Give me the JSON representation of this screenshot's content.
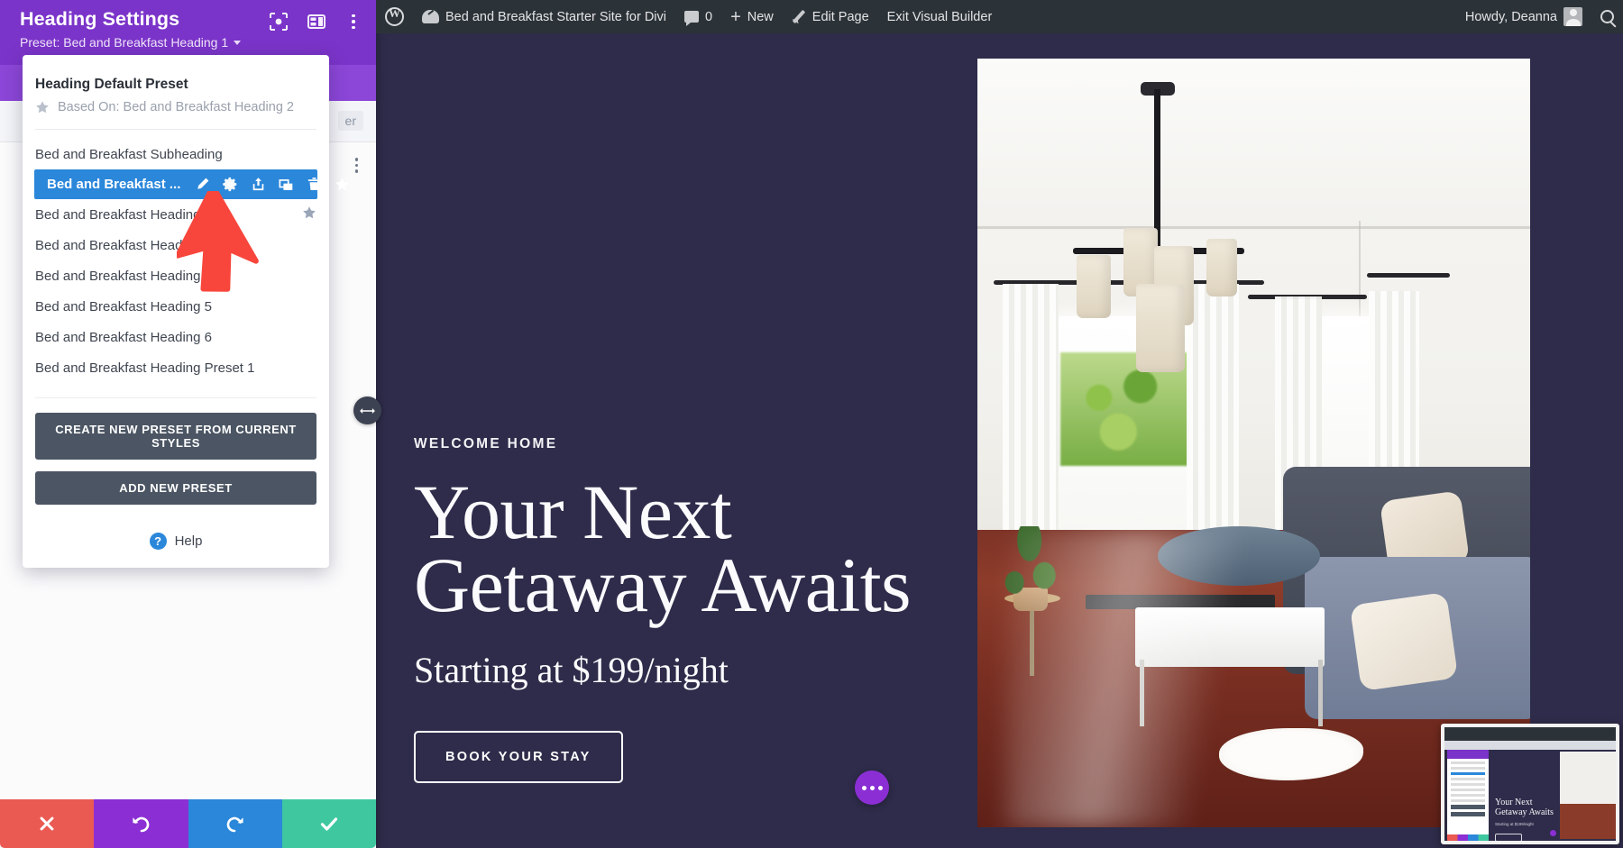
{
  "adminbar": {
    "logo_icon": "wordpress-logo-icon",
    "site_icon": "dashboard-icon",
    "site_name": "Bed and Breakfast Starter Site for Divi",
    "comments_icon": "comment-bubble-icon",
    "comments_count": "0",
    "new_icon": "plus-icon",
    "new_label": "New",
    "edit_icon": "pencil-icon",
    "edit_label": "Edit Page",
    "exit_label": "Exit Visual Builder",
    "howdy": "Howdy, Deanna",
    "avatar_icon": "avatar-icon",
    "search_icon": "search-icon"
  },
  "modal": {
    "title": "Heading Settings",
    "preset_label": "Preset: Bed and Breakfast Heading 1",
    "header_icons": [
      {
        "name": "focus-target-icon"
      },
      {
        "name": "layout-panel-icon"
      },
      {
        "name": "kebab-menu-icon"
      }
    ],
    "background_tab_label": "er",
    "dropdown": {
      "default_name": "Heading Default Preset",
      "based_on": "Based On: Bed and Breakfast Heading 2",
      "based_on_icon": "star-icon",
      "items": [
        {
          "label": "Bed and Breakfast Subheading",
          "selected": false,
          "starred": false
        },
        {
          "label": "Bed and Breakfast ...",
          "selected": true,
          "starred": false
        },
        {
          "label": "Bed and Breakfast Heading 2",
          "selected": false,
          "starred": true
        },
        {
          "label": "Bed and Breakfast Heading 3",
          "selected": false,
          "starred": false
        },
        {
          "label": "Bed and Breakfast Heading 4",
          "selected": false,
          "starred": false
        },
        {
          "label": "Bed and Breakfast Heading 5",
          "selected": false,
          "starred": false
        },
        {
          "label": "Bed and Breakfast Heading 6",
          "selected": false,
          "starred": false
        },
        {
          "label": "Bed and Breakfast Heading Preset 1",
          "selected": false,
          "starred": false
        }
      ],
      "row_actions": [
        {
          "name": "rename-pencil-icon"
        },
        {
          "name": "settings-gear-icon"
        },
        {
          "name": "export-icon"
        },
        {
          "name": "duplicate-icon"
        },
        {
          "name": "trash-icon"
        },
        {
          "name": "star-icon"
        }
      ],
      "create_preset_label": "CREATE NEW PRESET FROM CURRENT STYLES",
      "add_preset_label": "ADD NEW PRESET",
      "help_label": "Help",
      "help_icon": "help-question-icon"
    },
    "footer": [
      {
        "name": "cancel-button",
        "icon": "close-x-icon",
        "color": "#ea5a53"
      },
      {
        "name": "undo-button",
        "icon": "undo-arrow-icon",
        "color": "#8b2fd4"
      },
      {
        "name": "redo-button",
        "icon": "redo-arrow-icon",
        "color": "#2b87da"
      },
      {
        "name": "save-button",
        "icon": "checkmark-icon",
        "color": "#3fc8a0"
      }
    ]
  },
  "resize_handle_icon": "horizontal-resize-arrows-icon",
  "hero": {
    "eyebrow": "WELCOME HOME",
    "heading_line1": "Your Next",
    "heading_line2": "Getaway Awaits",
    "subheading": "Starting at $199/night",
    "cta_label": "BOOK YOUR STAY",
    "background_color": "#2e2c4a",
    "image_alt": "bright living room with chandelier, windows, sofa and hardwood floor"
  },
  "fab": {
    "name": "more-options-fab",
    "icon": "three-dots-icon",
    "color": "#8b2fd4"
  },
  "pip": {
    "name": "screen-recording-thumbnail",
    "heading_line1": "Your Next",
    "heading_line2": "Getaway Awaits",
    "subheading": "Starting at $199/night"
  }
}
